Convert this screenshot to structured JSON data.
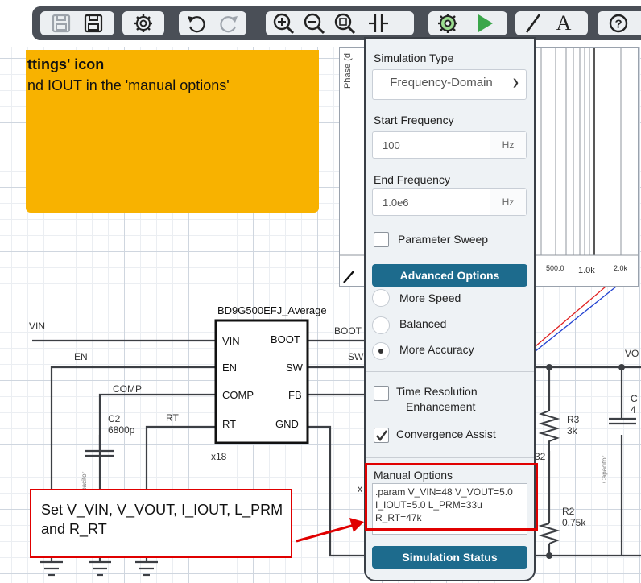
{
  "toolbar": {
    "buttons": [
      "save-icon",
      "save-as-icon",
      "settings-gear-icon",
      "undo-icon",
      "redo-icon",
      "zoom-in-icon",
      "zoom-out-icon",
      "zoom-fit-icon",
      "probe-icon",
      "simulation-settings-icon",
      "run-icon",
      "wire-icon",
      "text-icon",
      "help-icon"
    ],
    "help_glyph": "?",
    "text_glyph": "A"
  },
  "hint": {
    "title": "ttings' icon",
    "text": "nd IOUT  in the 'manual options'"
  },
  "plot": {
    "y_axis_label": "Phase (d",
    "x_ticks": [
      "500.0",
      "1.0k",
      "2.0k"
    ]
  },
  "panel": {
    "sim_type_label": "Simulation Type",
    "sim_type_value": "Frequency-Domain",
    "start_freq_label": "Start Frequency",
    "start_freq_value": "100",
    "start_freq_unit": "Hz",
    "end_freq_label": "End Frequency",
    "end_freq_value": "1.0e6",
    "end_freq_unit": "Hz",
    "param_sweep_label": "Parameter Sweep",
    "advanced_label": "Advanced Options",
    "radio_speed": "More Speed",
    "radio_balanced": "Balanced",
    "radio_accuracy": "More Accuracy",
    "time_res_label_1": "Time Resolution",
    "time_res_label_2": "Enhancement",
    "convergence_label": "Convergence Assist",
    "manual_label": "Manual Options",
    "manual_text": ".param V_VIN=48 V_VOUT=5.0\nI_IOUT=5.0 L_PRM=33u\nR_RT=47k",
    "status_label": "Simulation Status"
  },
  "schematic": {
    "ic_name": "BD9G500EFJ_Average",
    "pins_left": [
      "VIN",
      "EN",
      "COMP",
      "RT"
    ],
    "pins_right": [
      "BOOT",
      "SW",
      "FB",
      "GND"
    ],
    "net_vin": "VIN",
    "net_en": "EN",
    "net_comp": "COMP",
    "net_rt": "RT",
    "net_boot": "BOOT",
    "net_sw": "SW",
    "net_vo": "VO",
    "c2_name": "C2",
    "c2_value": "6800p",
    "cap_text": "Capacitor",
    "r3_name": "R3",
    "r3_value": "3k",
    "r2_name": "R2",
    "r2_value": "0.75k",
    "x18": "x18",
    "n32": "32",
    "x_partial": "x",
    "c_partial_1": "C",
    "c_partial_2": "4"
  },
  "callout": {
    "text": "Set V_VIN, V_VOUT, I_IOUT, L_PRM and R_RT"
  },
  "colors": {
    "toolbar_bg": "#4a4f57",
    "hint_bg": "#f8b200",
    "panel_bg": "#eef2f5",
    "button_blue": "#1d6b8d",
    "callout_red": "#e00000",
    "run_green": "#3aa64a"
  }
}
